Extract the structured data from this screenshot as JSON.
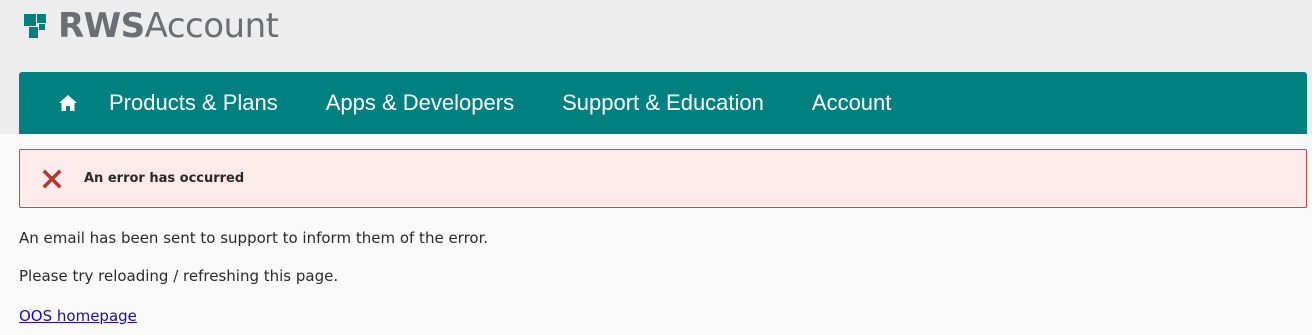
{
  "brand": {
    "logo_bold": "RWS",
    "logo_light": "Account",
    "mark_color": "#00807f",
    "logo_text_color": "#6b6e72"
  },
  "nav": {
    "background": "#00807f",
    "home_icon": "home-icon",
    "items": [
      {
        "label": "Products & Plans"
      },
      {
        "label": "Apps & Developers"
      },
      {
        "label": "Support & Education"
      },
      {
        "label": "Account"
      }
    ]
  },
  "alert": {
    "icon": "error-x-icon",
    "icon_color": "#b03a2e",
    "text": "An error has occurred",
    "background": "#fdeaea",
    "border": "#c9463d"
  },
  "content": {
    "message_1": "An email has been sent to support to inform them of the error.",
    "message_2": "Please try reloading / refreshing this page.",
    "link_label": "OOS homepage"
  }
}
